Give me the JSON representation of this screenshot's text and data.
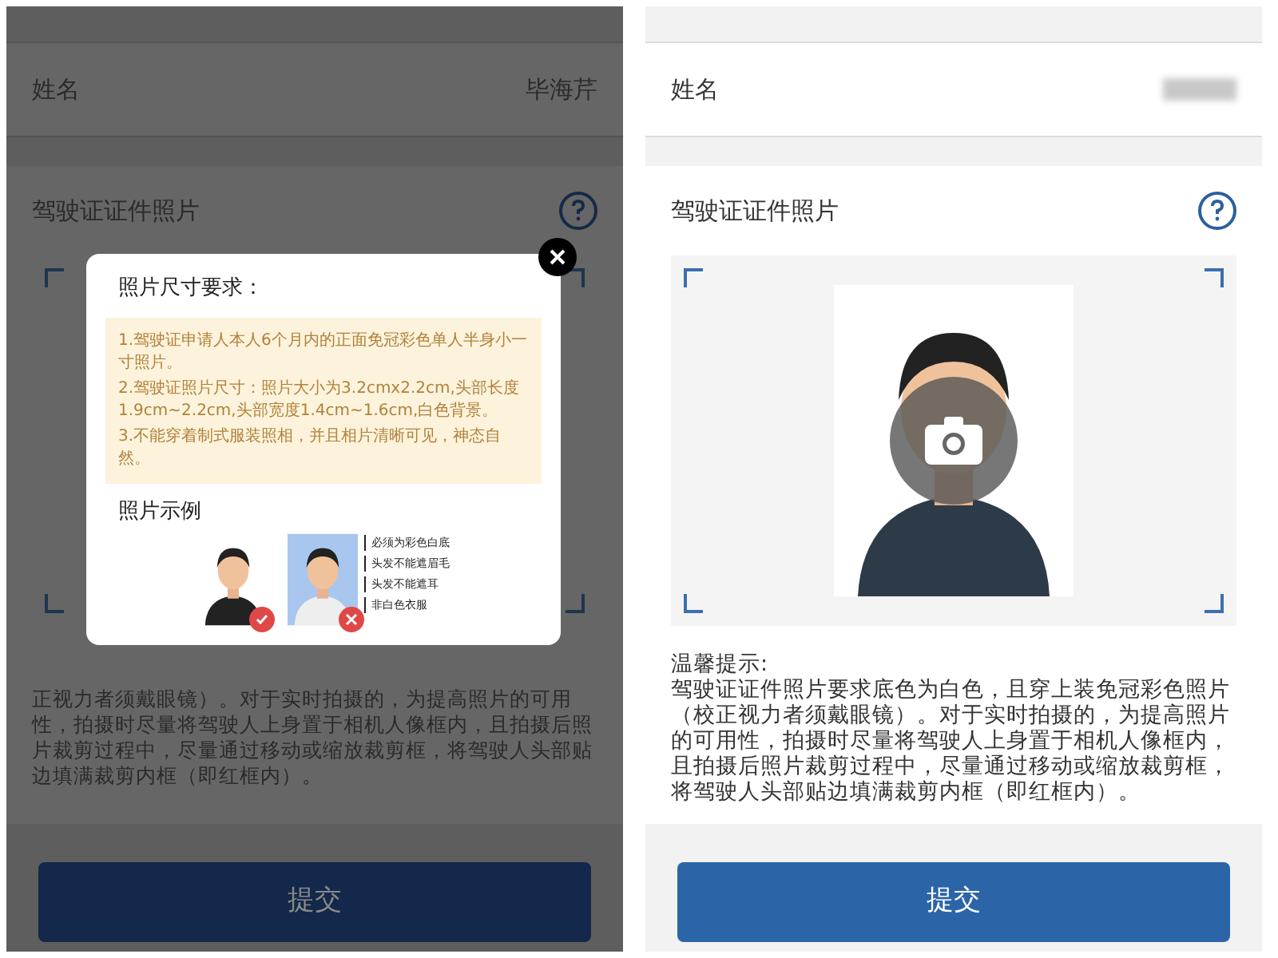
{
  "screens": [
    {
      "kind": "dimmed",
      "name_row": {
        "label": "姓名",
        "value": "毕海芹",
        "value_hidden": false
      },
      "photo_section": {
        "title": "驾驶证证件照片"
      },
      "tip_lines": [
        "正视力者须戴眼镜）。对于实时拍摄的，为提高照片的可用",
        "性，拍摄时尽量将驾驶人上身置于相机人像框内，且拍摄后照",
        "片裁剪过程中，尽量通过移动或缩放裁剪框，将驾驶人头部贴",
        "边填满裁剪内框（即红框内）。"
      ],
      "submit": "提交",
      "dialog": {
        "title": "照片尺寸要求：",
        "requirements": [
          "1.驾驶证申请人本人6个月内的正面免冠彩色单人半身小一寸照片。",
          "2.驾驶证照片尺寸：照片大小为3.2cmx2.2cm,头部长度1.9cm~2.2cm,头部宽度1.4cm~1.6cm,白色背景。",
          "3.不能穿着制式服装照相，并且相片清晰可见，神态自然。"
        ],
        "example_title": "照片示例",
        "examples": [
          {
            "correct": true
          },
          {
            "correct": false,
            "callouts": [
              "必须为彩色白底",
              "头发不能遮眉毛",
              "头发不能遮耳",
              "非白色衣服"
            ]
          }
        ]
      }
    },
    {
      "kind": "plain",
      "name_row": {
        "label": "姓名",
        "value_hidden": true
      },
      "photo_section": {
        "title": "驾驶证证件照片"
      },
      "tip_title": "温馨提示:",
      "tip_text": "驾驶证证件照片要求底色为白色，且穿上装免冠彩色照片（校正视力者须戴眼镜）。对于实时拍摄的，为提高照片的可用性，拍摄时尽量将驾驶人上身置于相机人像框内，且拍摄后照片裁剪过程中，尽量通过移动或缩放裁剪框，将驾驶人头部贴边填满裁剪内框（即红框内）。",
      "submit": "提交"
    }
  ]
}
